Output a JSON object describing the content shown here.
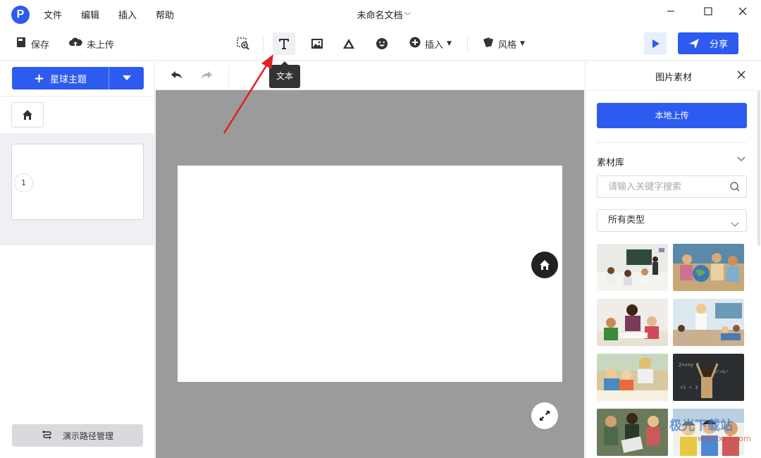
{
  "app": {
    "logo_letter": "P",
    "menu": [
      "文件",
      "编辑",
      "插入",
      "帮助"
    ],
    "doc_title": "未命名文档",
    "window_controls": [
      "minimize-icon",
      "maximize-icon",
      "close-icon"
    ]
  },
  "toolbar": {
    "save_label": "保存",
    "upload_status": "未上传",
    "tools": [
      "zoom-area-icon",
      "text-icon",
      "image-icon",
      "shape-icon",
      "emoji-icon"
    ],
    "insert_label": "插入",
    "style_label": "风格",
    "share_label": "分享",
    "active_tool": "text-icon",
    "tooltip": "文本"
  },
  "left_panel": {
    "theme_button_label": "星球主题",
    "slides": [
      {
        "number": "1"
      }
    ],
    "path_button_label": "演示路径管理"
  },
  "right_panel": {
    "title": "图片素材",
    "upload_label": "本地上传",
    "library_title": "素材库",
    "search_placeholder": "请输入关键字搜索",
    "type_select_value": "所有类型",
    "images": [
      "classroom-photo",
      "kids-globe-photo",
      "teacher-kids-photo",
      "teacher-classroom-photo",
      "teacher-kids-desk-photo",
      "chalkboard-photo",
      "kids-tablet-photo",
      "kids-smiling-photo"
    ]
  },
  "watermark": {
    "text": "极光下载站",
    "url": "www.xz7.com"
  },
  "colors": {
    "accent": "#2d5bf0",
    "canvas_bg": "#9b9b9b",
    "tooltip_bg": "#333333",
    "annotation_arrow": "#e02020"
  }
}
